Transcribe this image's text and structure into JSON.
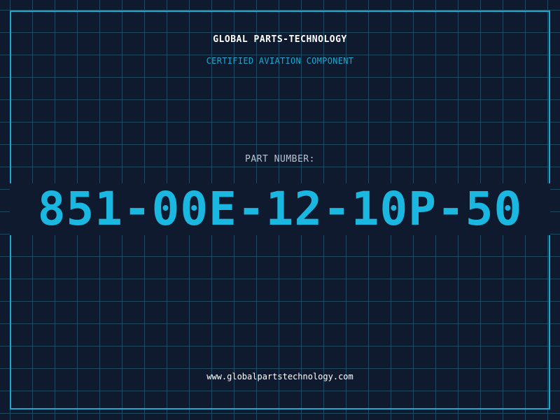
{
  "header": {
    "company": "GLOBAL PARTS-TECHNOLOGY",
    "tagline": "CERTIFIED AVIATION COMPONENT"
  },
  "part": {
    "label": "PART NUMBER:",
    "number": "851-00E-12-10P-50"
  },
  "footer": {
    "website": "www.globalpartstechnology.com"
  },
  "colors": {
    "background": "#0f1a2e",
    "grid": "#1d4a5e",
    "accent": "#1ab8e0",
    "frame": "#1aa7d0"
  }
}
